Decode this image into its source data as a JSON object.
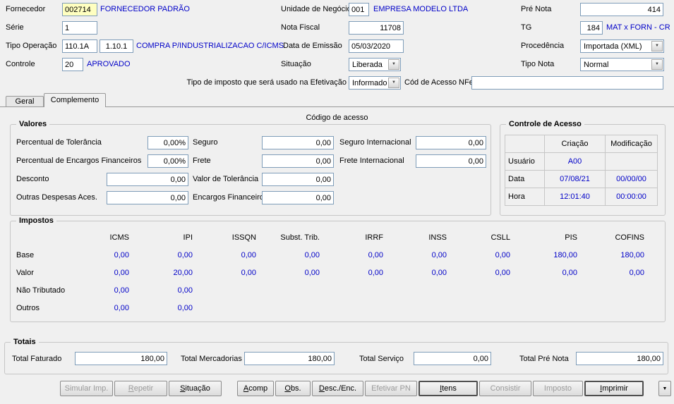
{
  "icons": {
    "dropdown_arrow": "▼"
  },
  "colors": {
    "value_blue": "#0000C8",
    "highlight_field": "#FFFFC0"
  },
  "header": {
    "fornecedor_label": "Fornecedor",
    "fornecedor_code": "002714",
    "fornecedor_desc": "FORNECEDOR PADRÃO",
    "unidade_label": "Unidade de Negócio",
    "unidade_code": "001",
    "unidade_desc": "EMPRESA MODELO LTDA",
    "pre_nota_label": "Pré Nota",
    "pre_nota_value": "414",
    "serie_label": "Série",
    "serie_value": "1",
    "nota_fiscal_label": "Nota Fiscal",
    "nota_fiscal_value": "11708",
    "tg_label": "TG",
    "tg_code": "184",
    "tg_desc": "MAT x FORN - CR",
    "tipo_operacao_label": "Tipo Operação",
    "tipo_operacao_code1": "110.1A",
    "tipo_operacao_code2": "1.10.1",
    "tipo_operacao_desc": "COMPRA P/INDUSTRIALIZACAO C/ICMS",
    "data_emissao_label": "Data de Emissão",
    "data_emissao_value": "05/03/2020",
    "procedencia_label": "Procedência",
    "procedencia_value": "Importada (XML)",
    "controle_label": "Controle",
    "controle_code": "20",
    "controle_desc": "APROVADO",
    "situacao_label": "Situação",
    "situacao_value": "Liberada",
    "tipo_nota_label": "Tipo Nota",
    "tipo_nota_value": "Normal",
    "tipo_imposto_label": "Tipo de imposto que será usado na Efetivação",
    "tipo_imposto_value": "Informado",
    "cod_acesso_nfe_label": "Cód de Acesso NFe",
    "cod_acesso_nfe_value": ""
  },
  "tabs": {
    "geral": "Geral",
    "complemento": "Complemento"
  },
  "codigo_acesso_caption": "Código de acesso",
  "valores": {
    "title": "Valores",
    "perc_tolerancia_label": "Percentual de Tolerância",
    "perc_tolerancia_value": "0,00%",
    "perc_encargos_label": "Percentual de Encargos Financeiros",
    "perc_encargos_value": "0,00%",
    "desconto_label": "Desconto",
    "desconto_value": "0,00",
    "outras_despesas_label": "Outras Despesas Aces.",
    "outras_despesas_value": "0,00",
    "seguro_label": "Seguro",
    "seguro_value": "0,00",
    "frete_label": "Frete",
    "frete_value": "0,00",
    "valor_tolerancia_label": "Valor de Tolerância",
    "valor_tolerancia_value": "0,00",
    "encargos_label": "Encargos Financeiros",
    "encargos_value": "0,00",
    "seguro_int_label": "Seguro Internacional",
    "seguro_int_value": "0,00",
    "frete_int_label": "Frete Internacional",
    "frete_int_value": "0,00"
  },
  "controle_acesso": {
    "title": "Controle de Acesso",
    "col_criacao": "Criação",
    "col_modificacao": "Modificação",
    "rows": [
      {
        "label": "Usuário",
        "criacao": "A00",
        "modificacao": ""
      },
      {
        "label": "Data",
        "criacao": "07/08/21",
        "modificacao": "00/00/00"
      },
      {
        "label": "Hora",
        "criacao": "12:01:40",
        "modificacao": "00:00:00"
      }
    ]
  },
  "impostos": {
    "title": "Impostos",
    "columns": [
      "ICMS",
      "IPI",
      "ISSQN",
      "Subst. Trib.",
      "IRRF",
      "INSS",
      "CSLL",
      "PIS",
      "COFINS"
    ],
    "rows": [
      {
        "label": "Base",
        "values": [
          "0,00",
          "0,00",
          "0,00",
          "0,00",
          "0,00",
          "0,00",
          "0,00",
          "180,00",
          "180,00"
        ]
      },
      {
        "label": "Valor",
        "values": [
          "0,00",
          "20,00",
          "0,00",
          "0,00",
          "0,00",
          "0,00",
          "0,00",
          "0,00",
          "0,00"
        ]
      },
      {
        "label": "Não Tributado",
        "values": [
          "0,00",
          "0,00",
          "",
          "",
          "",
          "",
          "",
          "",
          ""
        ]
      },
      {
        "label": "Outros",
        "values": [
          "0,00",
          "0,00",
          "",
          "",
          "",
          "",
          "",
          "",
          ""
        ]
      }
    ]
  },
  "totais": {
    "title": "Totais",
    "faturado_label": "Total Faturado",
    "faturado_value": "180,00",
    "mercadorias_label": "Total Mercadorias",
    "mercadorias_value": "180,00",
    "servico_label": "Total Serviço",
    "servico_value": "0,00",
    "pre_nota_label": "Total Pré Nota",
    "pre_nota_value": "180,00"
  },
  "buttons": [
    {
      "label": "Simular Imp.",
      "enabled": false
    },
    {
      "label": "Repetir",
      "enabled": false
    },
    {
      "label": "Situação",
      "enabled": true
    },
    {
      "label": "Acomp",
      "enabled": true
    },
    {
      "label": "Obs.",
      "enabled": true
    },
    {
      "label": "Desc./Enc.",
      "enabled": true
    },
    {
      "label": "Efetivar PN",
      "enabled": false
    },
    {
      "label": "Itens",
      "enabled": true
    },
    {
      "label": "Consistir",
      "enabled": false
    },
    {
      "label": "Imposto",
      "enabled": false
    },
    {
      "label": "Imprimir",
      "enabled": true
    }
  ]
}
